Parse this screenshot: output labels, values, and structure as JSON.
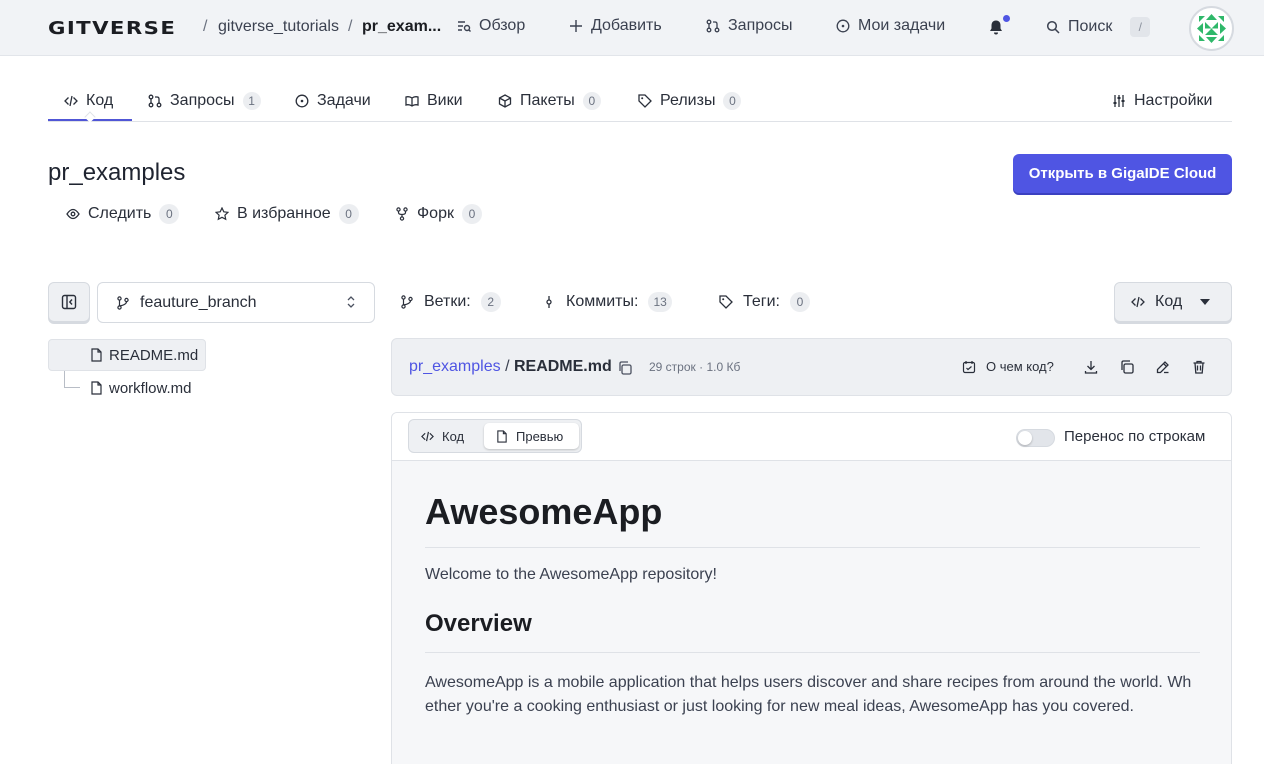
{
  "topbar": {
    "logo": "GITVERSE",
    "breadcrumb": {
      "owner": "gitverse_tutorials",
      "sep": "/",
      "repo": "pr_exam..."
    },
    "nav": [
      {
        "label": "Обзор",
        "icon": "overview-icon"
      },
      {
        "label": "Добавить",
        "icon": "plus-icon"
      },
      {
        "label": "Запросы",
        "icon": "pull-request-icon"
      },
      {
        "label": "Мои задачи",
        "icon": "issue-icon"
      }
    ],
    "search_label": "Поиск",
    "search_shortcut": "/",
    "notification_dot_color": "#4f55e3"
  },
  "repo_tabs": [
    {
      "label": "Код",
      "icon": "code-icon"
    },
    {
      "label": "Запросы",
      "icon": "pull-request-icon",
      "count": "1"
    },
    {
      "label": "Задачи",
      "icon": "issue-icon"
    },
    {
      "label": "Вики",
      "icon": "book-icon"
    },
    {
      "label": "Пакеты",
      "icon": "package-icon",
      "count": "0"
    },
    {
      "label": "Релизы",
      "icon": "tag-icon",
      "count": "0"
    }
  ],
  "settings_label": "Настройки",
  "repo": {
    "name": "pr_examples",
    "open_button": "Открыть в GigaIDE Cloud",
    "watch": {
      "label": "Следить",
      "count": "0"
    },
    "star": {
      "label": "В избранное",
      "count": "0"
    },
    "fork": {
      "label": "Форк",
      "count": "0"
    }
  },
  "branch": {
    "name": "feauture_branch"
  },
  "tree": [
    {
      "name": "README.md",
      "selected": true
    },
    {
      "name": "workflow.md",
      "selected": false
    }
  ],
  "meta": {
    "branches": {
      "label": "Ветки:",
      "count": "2"
    },
    "commits": {
      "label": "Коммиты:",
      "count": "13"
    },
    "tags": {
      "label": "Теги:",
      "count": "0"
    }
  },
  "code_button": "Код",
  "file": {
    "repo_link": "pr_examples",
    "sep": "/",
    "name": "README.md",
    "info": "29 строк · 1.0 Кб",
    "about": "О чем код?"
  },
  "preview": {
    "mode_code": "Код",
    "mode_preview": "Превью",
    "wrap_label": "Перенос по строкам",
    "wrap_enabled": false,
    "h1": "AwesomeApp",
    "intro": "Welcome to the AwesomeApp repository!",
    "h2": "Overview",
    "body": "AwesomeApp is a mobile application that helps users discover and share recipes from around the world. Whether you're a cooking enthusiast or just looking for new meal ideas, AwesomeApp has you covered."
  },
  "colors": {
    "accent": "#4f55e3",
    "topbar_bg": "#f1f3f6",
    "panel_bg": "#eef0f3"
  }
}
